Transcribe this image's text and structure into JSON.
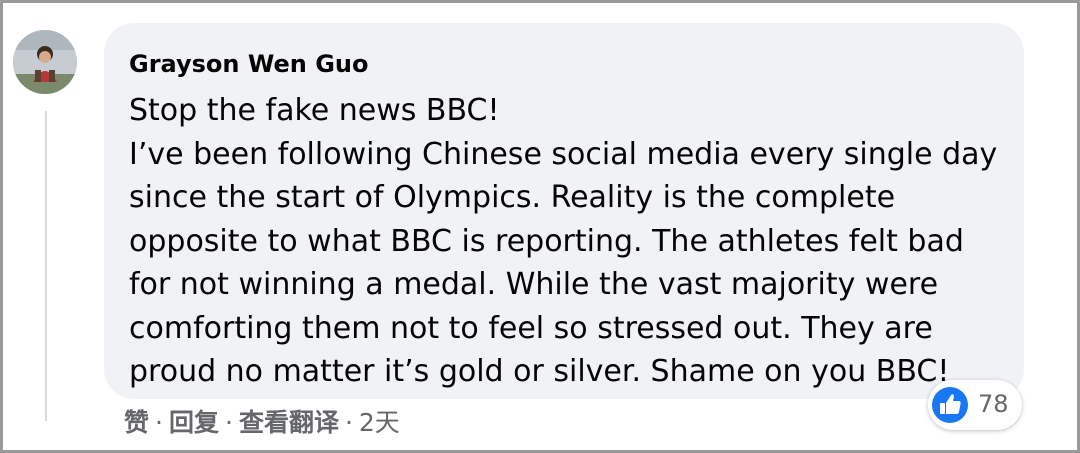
{
  "comment": {
    "author": "Grayson Wen Guo",
    "text_lines": [
      "Stop the fake news BBC!",
      "I’ve been following Chinese social media every single day",
      "since the start of Olympics. Reality is the complete",
      "opposite to what BBC is reporting. The athletes felt bad",
      "for not winning a medal. While the vast majority were",
      "comforting them not to feel so stressed out. They are",
      "proud no matter it’s gold or silver. Shame on you BBC!"
    ],
    "reactions": {
      "icon": "thumbs-up-icon",
      "count": "78",
      "color": "#1877f2"
    },
    "actions": {
      "like_label": "赞",
      "reply_label": "回复",
      "see_translation_label": "查看翻译",
      "separator": "·",
      "timestamp": "2天"
    }
  },
  "colors": {
    "bubble_background": "#f0f2f5",
    "text_primary": "#050505",
    "text_secondary": "#65676b",
    "frame_border": "#9a9a9a"
  }
}
